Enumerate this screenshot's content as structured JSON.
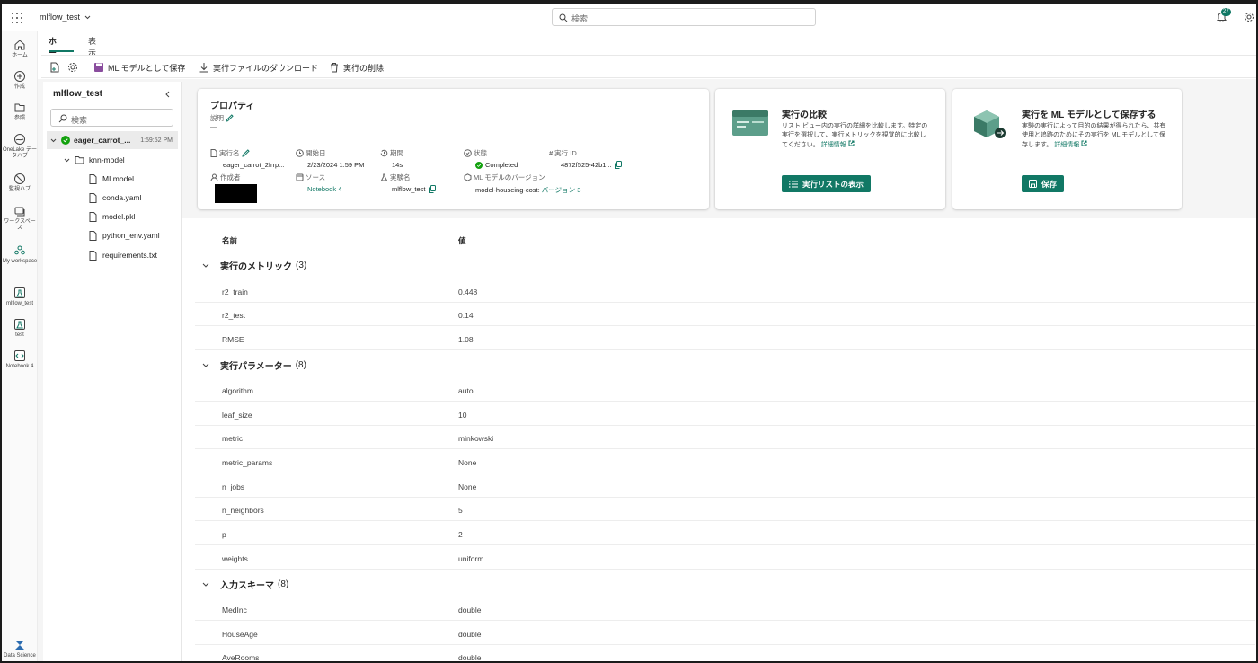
{
  "topbar": {
    "workspace": "mlflow_test",
    "search_placeholder": "検索",
    "notif_count": "27"
  },
  "rail": [
    {
      "label": "ホーム",
      "icon": "home-icon"
    },
    {
      "label": "作成",
      "icon": "plus-circle-icon"
    },
    {
      "label": "参照",
      "icon": "folder-icon"
    },
    {
      "label": "OneLake データハブ",
      "icon": "onelake-icon"
    },
    {
      "label": "監視ハブ",
      "icon": "monitor-icon"
    },
    {
      "label": "ワークスペース",
      "icon": "workspaces-icon"
    },
    {
      "label": "My workspace",
      "icon": "my-workspace-icon"
    },
    {
      "label": "mlflow_test",
      "icon": "experiment-icon"
    },
    {
      "label": "test",
      "icon": "experiment-icon"
    },
    {
      "label": "Notebook 4",
      "icon": "notebook-icon"
    },
    {
      "label": "Data Science",
      "icon": "data-science-icon"
    }
  ],
  "tabs": {
    "home": "ホーム",
    "view": "表示"
  },
  "toolbar": {
    "save_model": "ML モデルとして保存",
    "download": "実行ファイルのダウンロード",
    "delete": "実行の削除"
  },
  "tree": {
    "title": "mlflow_test",
    "search_placeholder": "検索",
    "run": {
      "name": "eager_carrot_...",
      "time": "1:59:52 PM"
    },
    "folder": "knn-model",
    "files": [
      "MLmodel",
      "conda.yaml",
      "model.pkl",
      "python_env.yaml",
      "requirements.txt"
    ]
  },
  "props": {
    "title": "プロパティ",
    "desc_label": "説明",
    "desc_value": "—",
    "run_name_label": "実行名",
    "run_name": "eager_carrot_2frrp...",
    "start_label": "開始日",
    "start": "2/23/2024 1:59 PM",
    "duration_label": "期間",
    "duration": "14s",
    "status_label": "状態",
    "status": "Completed",
    "run_id_label": "実行 ID",
    "run_id": "4872f525-42b1...",
    "creator_label": "作成者",
    "source_label": "ソース",
    "source": "Notebook 4",
    "exp_label": "実験名",
    "exp": "mlflow_test",
    "model_ver_label": "ML モデルのバージョン",
    "model_ver": "model-houseing-cost: ",
    "model_ver_link": "バージョン 3"
  },
  "compare_card": {
    "title": "実行の比較",
    "desc": "リスト ビュー内の実行の詳細を比較します。特定の実行を選択して、実行メトリックを視覚的に比較してください。",
    "more": "詳細情報",
    "button": "実行リストの表示"
  },
  "save_card": {
    "title": "実行を ML モデルとして保存する",
    "desc": "実験の実行によって目的の結果が得られたら、共有使用と追跡のためにその実行を ML モデルとして保存します。",
    "more": "詳細情報",
    "button": "保存"
  },
  "table": {
    "col_name": "名前",
    "col_value": "値",
    "sections": [
      {
        "title": "実行のメトリック",
        "count": "(3)",
        "rows": [
          [
            "r2_train",
            "0.448"
          ],
          [
            "r2_test",
            "0.14"
          ],
          [
            "RMSE",
            "1.08"
          ]
        ]
      },
      {
        "title": "実行パラメーター",
        "count": "(8)",
        "rows": [
          [
            "algorithm",
            "auto"
          ],
          [
            "leaf_size",
            "10"
          ],
          [
            "metric",
            "minkowski"
          ],
          [
            "metric_params",
            "None"
          ],
          [
            "n_jobs",
            "None"
          ],
          [
            "n_neighbors",
            "5"
          ],
          [
            "p",
            "2"
          ],
          [
            "weights",
            "uniform"
          ]
        ]
      },
      {
        "title": "入力スキーマ",
        "count": "(8)",
        "rows": [
          [
            "MedInc",
            "double"
          ],
          [
            "HouseAge",
            "double"
          ],
          [
            "AveRooms",
            "double"
          ]
        ]
      }
    ]
  },
  "colors": {
    "accent": "#117865",
    "status_green": "#13a10e"
  }
}
